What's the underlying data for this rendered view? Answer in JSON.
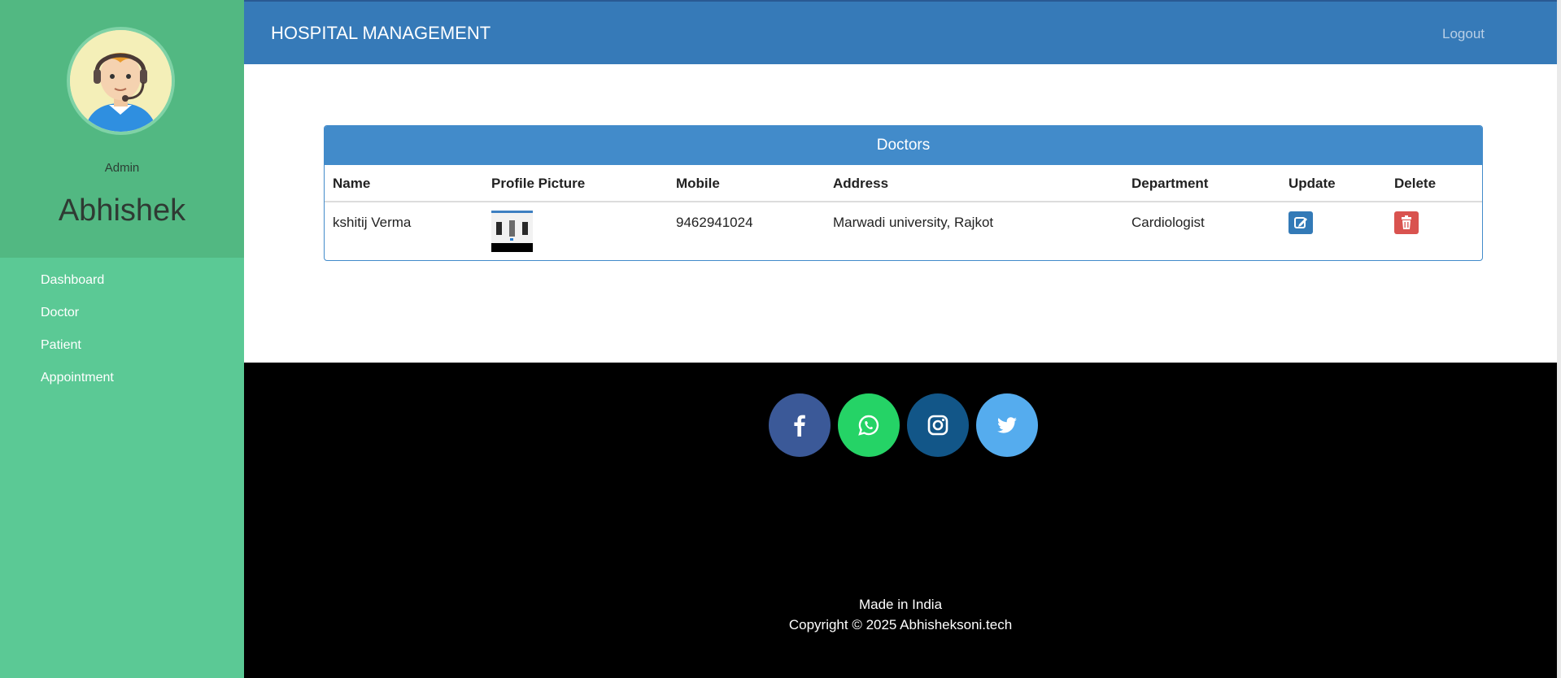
{
  "sidebar": {
    "role": "Admin",
    "name": "Abhishek",
    "nav": [
      {
        "label": "Dashboard"
      },
      {
        "label": "Doctor"
      },
      {
        "label": "Patient"
      },
      {
        "label": "Appointment"
      }
    ]
  },
  "header": {
    "brand": "HOSPITAL MANAGEMENT",
    "logout": "Logout"
  },
  "doctors_panel": {
    "title": "Doctors",
    "columns": [
      "Name",
      "Profile Picture",
      "Mobile",
      "Address",
      "Department",
      "Update",
      "Delete"
    ],
    "rows": [
      {
        "name": "kshitij Verma",
        "mobile": "9462941024",
        "address": "Marwadi university, Rajkot",
        "department": "Cardiologist"
      }
    ]
  },
  "footer": {
    "social": [
      {
        "icon": "facebook-icon",
        "color": "#3b5998"
      },
      {
        "icon": "whatsapp-icon",
        "color": "#25d366"
      },
      {
        "icon": "instagram-icon",
        "color": "#125688"
      },
      {
        "icon": "twitter-icon",
        "color": "#55acee"
      }
    ],
    "made": "Made in India",
    "copyright": "Copyright © 2025 Abhisheksoni.tech"
  },
  "colors": {
    "sidebar": "#5bc995",
    "sidebar_top": "#52b882",
    "header": "#367ab8",
    "panel": "#428bca",
    "update": "#337ab7",
    "delete": "#d9534f"
  }
}
